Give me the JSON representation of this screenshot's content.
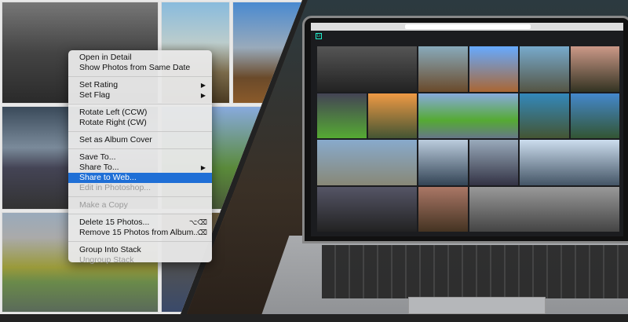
{
  "menu": {
    "items": [
      {
        "label": "Open in Detail"
      },
      {
        "label": "Show Photos from Same Date"
      },
      {
        "label": "Set Rating",
        "submenu": true
      },
      {
        "label": "Set Flag",
        "submenu": true
      },
      {
        "label": "Rotate Left (CCW)"
      },
      {
        "label": "Rotate Right (CW)"
      },
      {
        "label": "Set as Album Cover"
      },
      {
        "label": "Save To..."
      },
      {
        "label": "Share To...",
        "submenu": true
      },
      {
        "label": "Share to Web...",
        "highlighted": true
      },
      {
        "label": "Edit in Photoshop...",
        "disabled": true
      },
      {
        "label": "Make a Copy",
        "disabled": true
      },
      {
        "label": "Delete 15 Photos...",
        "shortcut": "⌥⌫"
      },
      {
        "label": "Remove 15 Photos from Album...",
        "shortcut": "⌫"
      },
      {
        "label": "Group Into Stack"
      },
      {
        "label": "Ungroup Stack",
        "disabled": true
      }
    ],
    "submenu_icon": "▶"
  },
  "laptop": {
    "app_logo": "Lr"
  },
  "colors": {
    "highlight": "#1f6fd6",
    "app_bg": "#1b1c1f"
  }
}
